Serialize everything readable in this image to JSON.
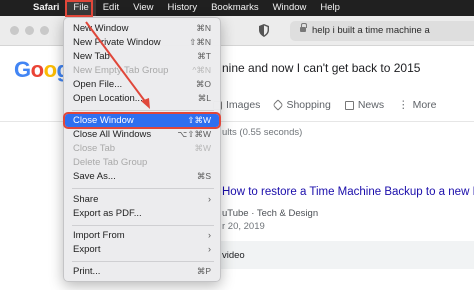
{
  "menubar": {
    "apple": "",
    "items": [
      "Safari",
      "File",
      "Edit",
      "View",
      "History",
      "Bookmarks",
      "Window",
      "Help"
    ],
    "active": "File"
  },
  "browser": {
    "url_text": "help i built a time machine a",
    "search_query": "nine and now I can't get back to 2015"
  },
  "google": {
    "logo_letters": [
      "G",
      "o",
      "o",
      "g"
    ],
    "tabs": {
      "images": "Images",
      "shopping": "Shopping",
      "news": "News",
      "more": "More"
    },
    "stats": "ults (0.55 seconds)",
    "result_title": "How to restore a Time Machine Backup to a new Mac",
    "result_source": "uTube · Tech & Design",
    "result_date": "r 20, 2019",
    "video_label": "video"
  },
  "file_menu": {
    "new_window": {
      "label": "New Window",
      "shortcut": "⌘N"
    },
    "new_private_window": {
      "label": "New Private Window",
      "shortcut": "⇧⌘N"
    },
    "new_tab": {
      "label": "New Tab",
      "shortcut": "⌘T"
    },
    "new_empty_tab_group": {
      "label": "New Empty Tab Group",
      "shortcut": "^⌘N"
    },
    "open_file": {
      "label": "Open File...",
      "shortcut": "⌘O"
    },
    "open_location": {
      "label": "Open Location...",
      "shortcut": "⌘L"
    },
    "close_window": {
      "label": "Close Window",
      "shortcut": "⇧⌘W"
    },
    "close_all_windows": {
      "label": "Close All Windows",
      "shortcut": "⌥⇧⌘W"
    },
    "close_tab": {
      "label": "Close Tab",
      "shortcut": "⌘W"
    },
    "delete_tab_group": {
      "label": "Delete Tab Group",
      "shortcut": ""
    },
    "save_as": {
      "label": "Save As...",
      "shortcut": "⌘S"
    },
    "share": {
      "label": "Share"
    },
    "export_as_pdf": {
      "label": "Export as PDF..."
    },
    "import_from": {
      "label": "Import From"
    },
    "export": {
      "label": "Export"
    },
    "print": {
      "label": "Print...",
      "shortcut": "⌘P"
    }
  },
  "colors": {
    "menubar_bg": "#202020",
    "highlight": "#2e6ff0",
    "annotation_red": "#e0473a"
  }
}
